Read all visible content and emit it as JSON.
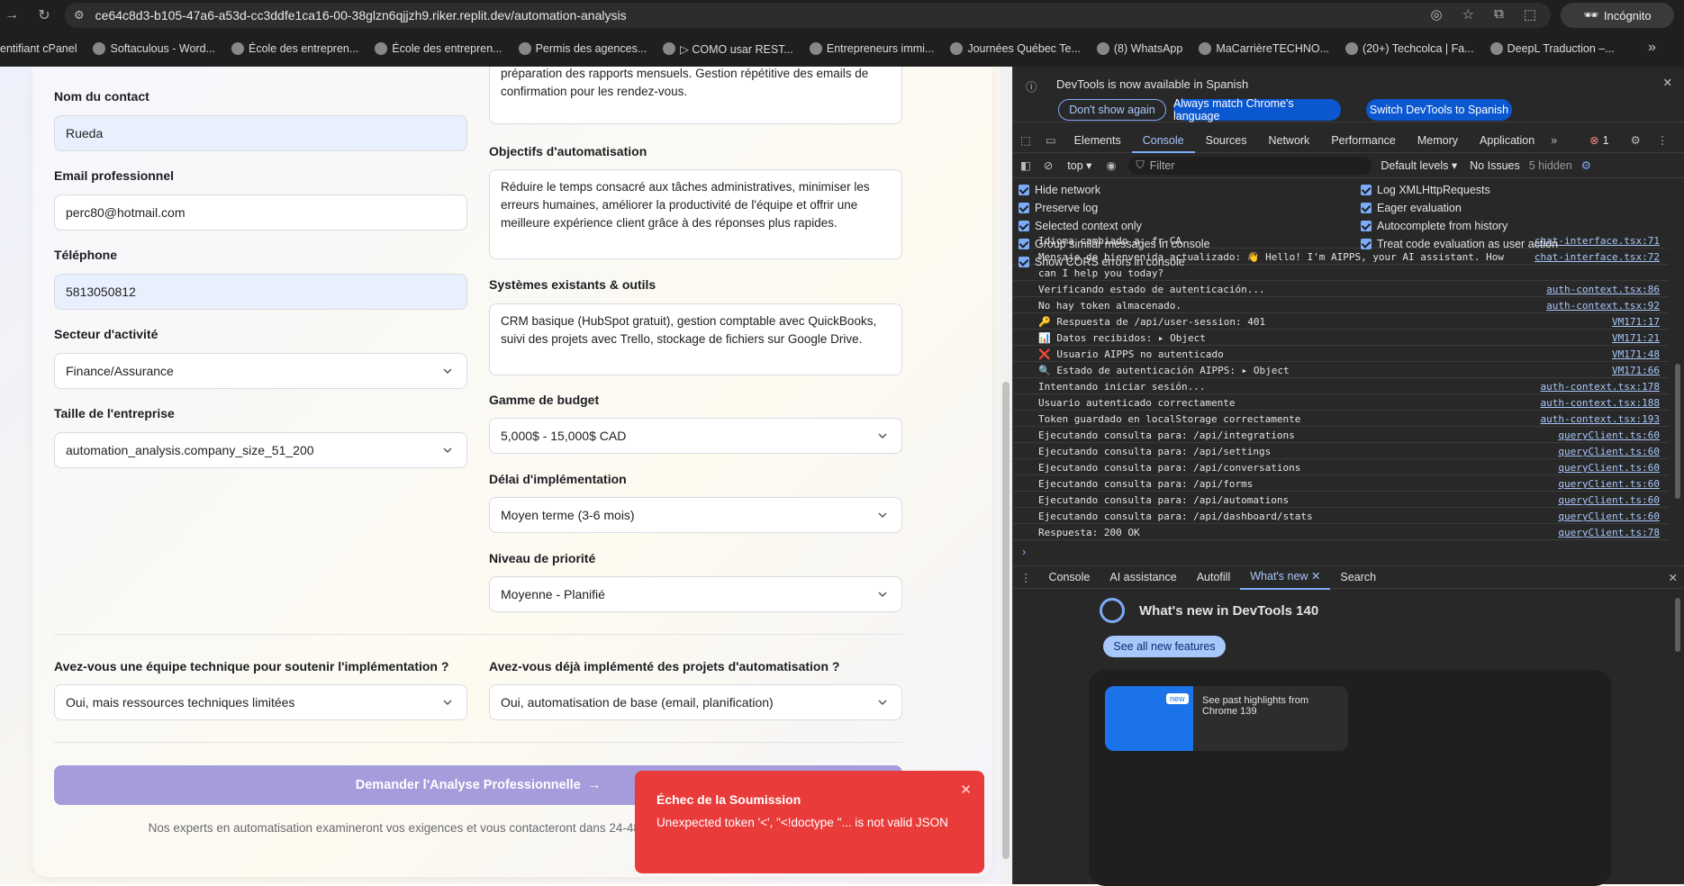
{
  "browser": {
    "url": "ce64c8d3-b105-47a6-a53d-cc3ddfe1ca16-00-38glzn6qjjzh9.riker.replit.dev/automation-analysis",
    "incognito_label": "Incógnito",
    "bookmarks": [
      "entifiant cPanel",
      "Softaculous - Word...",
      "École des entrepren...",
      "École des entrepren...",
      "Permis des agences...",
      "▷ COMO usar REST...",
      "Entrepreneurs immi...",
      "Journées Québec Te...",
      "(8) WhatsApp",
      "MaCarrièreTECHNO...",
      "(20+) Techcolca | Fa...",
      "DeepL Traduction –..."
    ]
  },
  "form": {
    "top_text": "préparation des rapports mensuels. Gestion répétitive des emails de confirmation pour les rendez-vous.",
    "contact_name_label": "Nom du contact",
    "contact_name_value": "Rueda",
    "email_label": "Email professionnel",
    "email_value": "perc80@hotmail.com",
    "phone_label": "Téléphone",
    "phone_value": "5813050812",
    "sector_label": "Secteur d'activité",
    "sector_value": "Finance/Assurance",
    "size_label": "Taille de l'entreprise",
    "size_value": "automation_analysis.company_size_51_200",
    "objectives_label": "Objectifs d'automatisation",
    "objectives_value": "Réduire le temps consacré aux tâches administratives, minimiser les erreurs humaines, améliorer la productivité de l'équipe et offrir une meilleure expérience client grâce à des réponses plus rapides.",
    "systems_label": "Systèmes existants & outils",
    "systems_value": "CRM basique (HubSpot gratuit), gestion comptable avec QuickBooks, suivi des projets avec Trello, stockage de fichiers sur Google Drive.",
    "budget_label": "Gamme de budget",
    "budget_value": "5,000$ - 15,000$ CAD",
    "delay_label": "Délai d'implémentation",
    "delay_value": "Moyen terme (3-6 mois)",
    "priority_label": "Niveau de priorité",
    "priority_value": "Moyenne - Planifié",
    "team_label": "Avez-vous une équipe technique pour soutenir l'implémentation ?",
    "team_value": "Oui, mais ressources techniques limitées",
    "projects_label": "Avez-vous déjà implémenté des projets d'automatisation ?",
    "projects_value": "Oui, automatisation de base (email, planification)",
    "submit_label": "Demander l'Analyse Professionnelle",
    "note": "Nos experts en automatisation examineront vos exigences et vous contacteront dans 24-48 heures avec d'implémentation."
  },
  "toast": {
    "title": "Échec de la Soumission",
    "message": "Unexpected token '<', \"<!doctype \"... is not valid JSON"
  },
  "devtools": {
    "banner_text": "DevTools is now available in Spanish",
    "btn_dont_show": "Don't show again",
    "btn_always_match": "Always match Chrome's language",
    "btn_switch": "Switch DevTools to Spanish",
    "tabs": [
      "Elements",
      "Console",
      "Sources",
      "Network",
      "Performance",
      "Memory",
      "Application"
    ],
    "error_count": "1",
    "context": "top",
    "filter_placeholder": "Filter",
    "levels": "Default levels",
    "issues": "No Issues",
    "hidden": "5 hidden",
    "options_left": [
      "Hide network",
      "Preserve log",
      "Selected context only",
      "Group similar messages in console",
      "Show CORS errors in console"
    ],
    "options_right": [
      "Log XMLHttpRequests",
      "Eager evaluation",
      "Autocomplete from history",
      "Treat code evaluation as user action"
    ],
    "logs": [
      {
        "msg": "Idioma cambiado a: fr-CA",
        "src": "chat-interface.tsx:71"
      },
      {
        "msg": "Mensaje de bienvenida actualizado: 👋 Hello! I'm AIPPS, your AI assistant. How",
        "src": "chat-interface.tsx:72"
      },
      {
        "msg": "can I help you today?",
        "src": ""
      },
      {
        "msg": "Verificando estado de autenticación...",
        "src": "auth-context.tsx:86"
      },
      {
        "msg": "No hay token almacenado.",
        "src": "auth-context.tsx:92"
      },
      {
        "msg": "🔑 Respuesta de /api/user-session: 401",
        "src": "VM171:17"
      },
      {
        "msg": "📊 Datos recibidos: ▸ Object",
        "src": "VM171:21"
      },
      {
        "msg": "❌ Usuario AIPPS no autenticado",
        "src": "VM171:48"
      },
      {
        "msg": "🔍 Estado de autenticación AIPPS: ▸ Object",
        "src": "VM171:66"
      },
      {
        "msg": "Intentando iniciar sesión...",
        "src": "auth-context.tsx:178"
      },
      {
        "msg": "Usuario autenticado correctamente",
        "src": "auth-context.tsx:188"
      },
      {
        "msg": "Token guardado en localStorage correctamente",
        "src": "auth-context.tsx:193"
      },
      {
        "msg": "Ejecutando consulta para: /api/integrations",
        "src": "queryClient.ts:60"
      },
      {
        "msg": "Ejecutando consulta para: /api/settings",
        "src": "queryClient.ts:60"
      },
      {
        "msg": "Ejecutando consulta para: /api/conversations",
        "src": "queryClient.ts:60"
      },
      {
        "msg": "Ejecutando consulta para: /api/forms",
        "src": "queryClient.ts:60"
      },
      {
        "msg": "Ejecutando consulta para: /api/automations",
        "src": "queryClient.ts:60"
      },
      {
        "msg": "Ejecutando consulta para: /api/dashboard/stats",
        "src": "queryClient.ts:60"
      },
      {
        "msg": "Respuesta: 200 OK",
        "src": "queryClient.ts:78"
      }
    ],
    "drawer_tabs": [
      "Console",
      "AI assistance",
      "Autofill",
      "What's new",
      "Search"
    ],
    "whats_new_title": "What's new in DevTools 140",
    "see_all": "See all new features",
    "highlight_badge": "new",
    "highlight_text": "See past highlights from Chrome 139"
  }
}
